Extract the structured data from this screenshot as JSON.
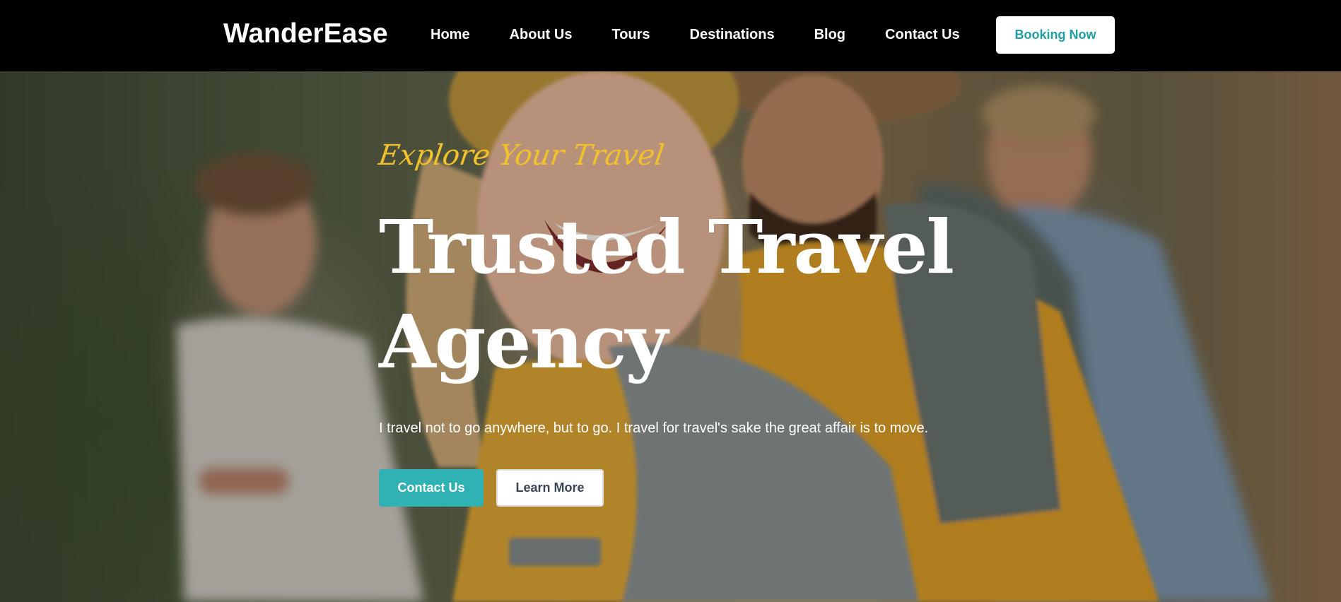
{
  "header": {
    "logo": "WanderEase",
    "nav": [
      {
        "label": "Home"
      },
      {
        "label": "About Us"
      },
      {
        "label": "Tours"
      },
      {
        "label": "Destinations"
      },
      {
        "label": "Blog"
      },
      {
        "label": "Contact Us"
      }
    ],
    "cta_label": "Booking Now"
  },
  "hero": {
    "tagline": "Explore Your Travel",
    "title": "Trusted Travel Agency",
    "description": "I travel not to go anywhere, but to go. I travel for travel's sake the great affair is to move.",
    "primary_button": "Contact Us",
    "secondary_button": "Learn More",
    "background_image": "group-of-smiling-hikers-photo"
  },
  "colors": {
    "header_bg": "#000000",
    "accent_teal": "#30b2b4",
    "tagline_yellow": "#f2c22c",
    "cta_text": "#1e9ea3",
    "text_white": "#ffffff"
  }
}
